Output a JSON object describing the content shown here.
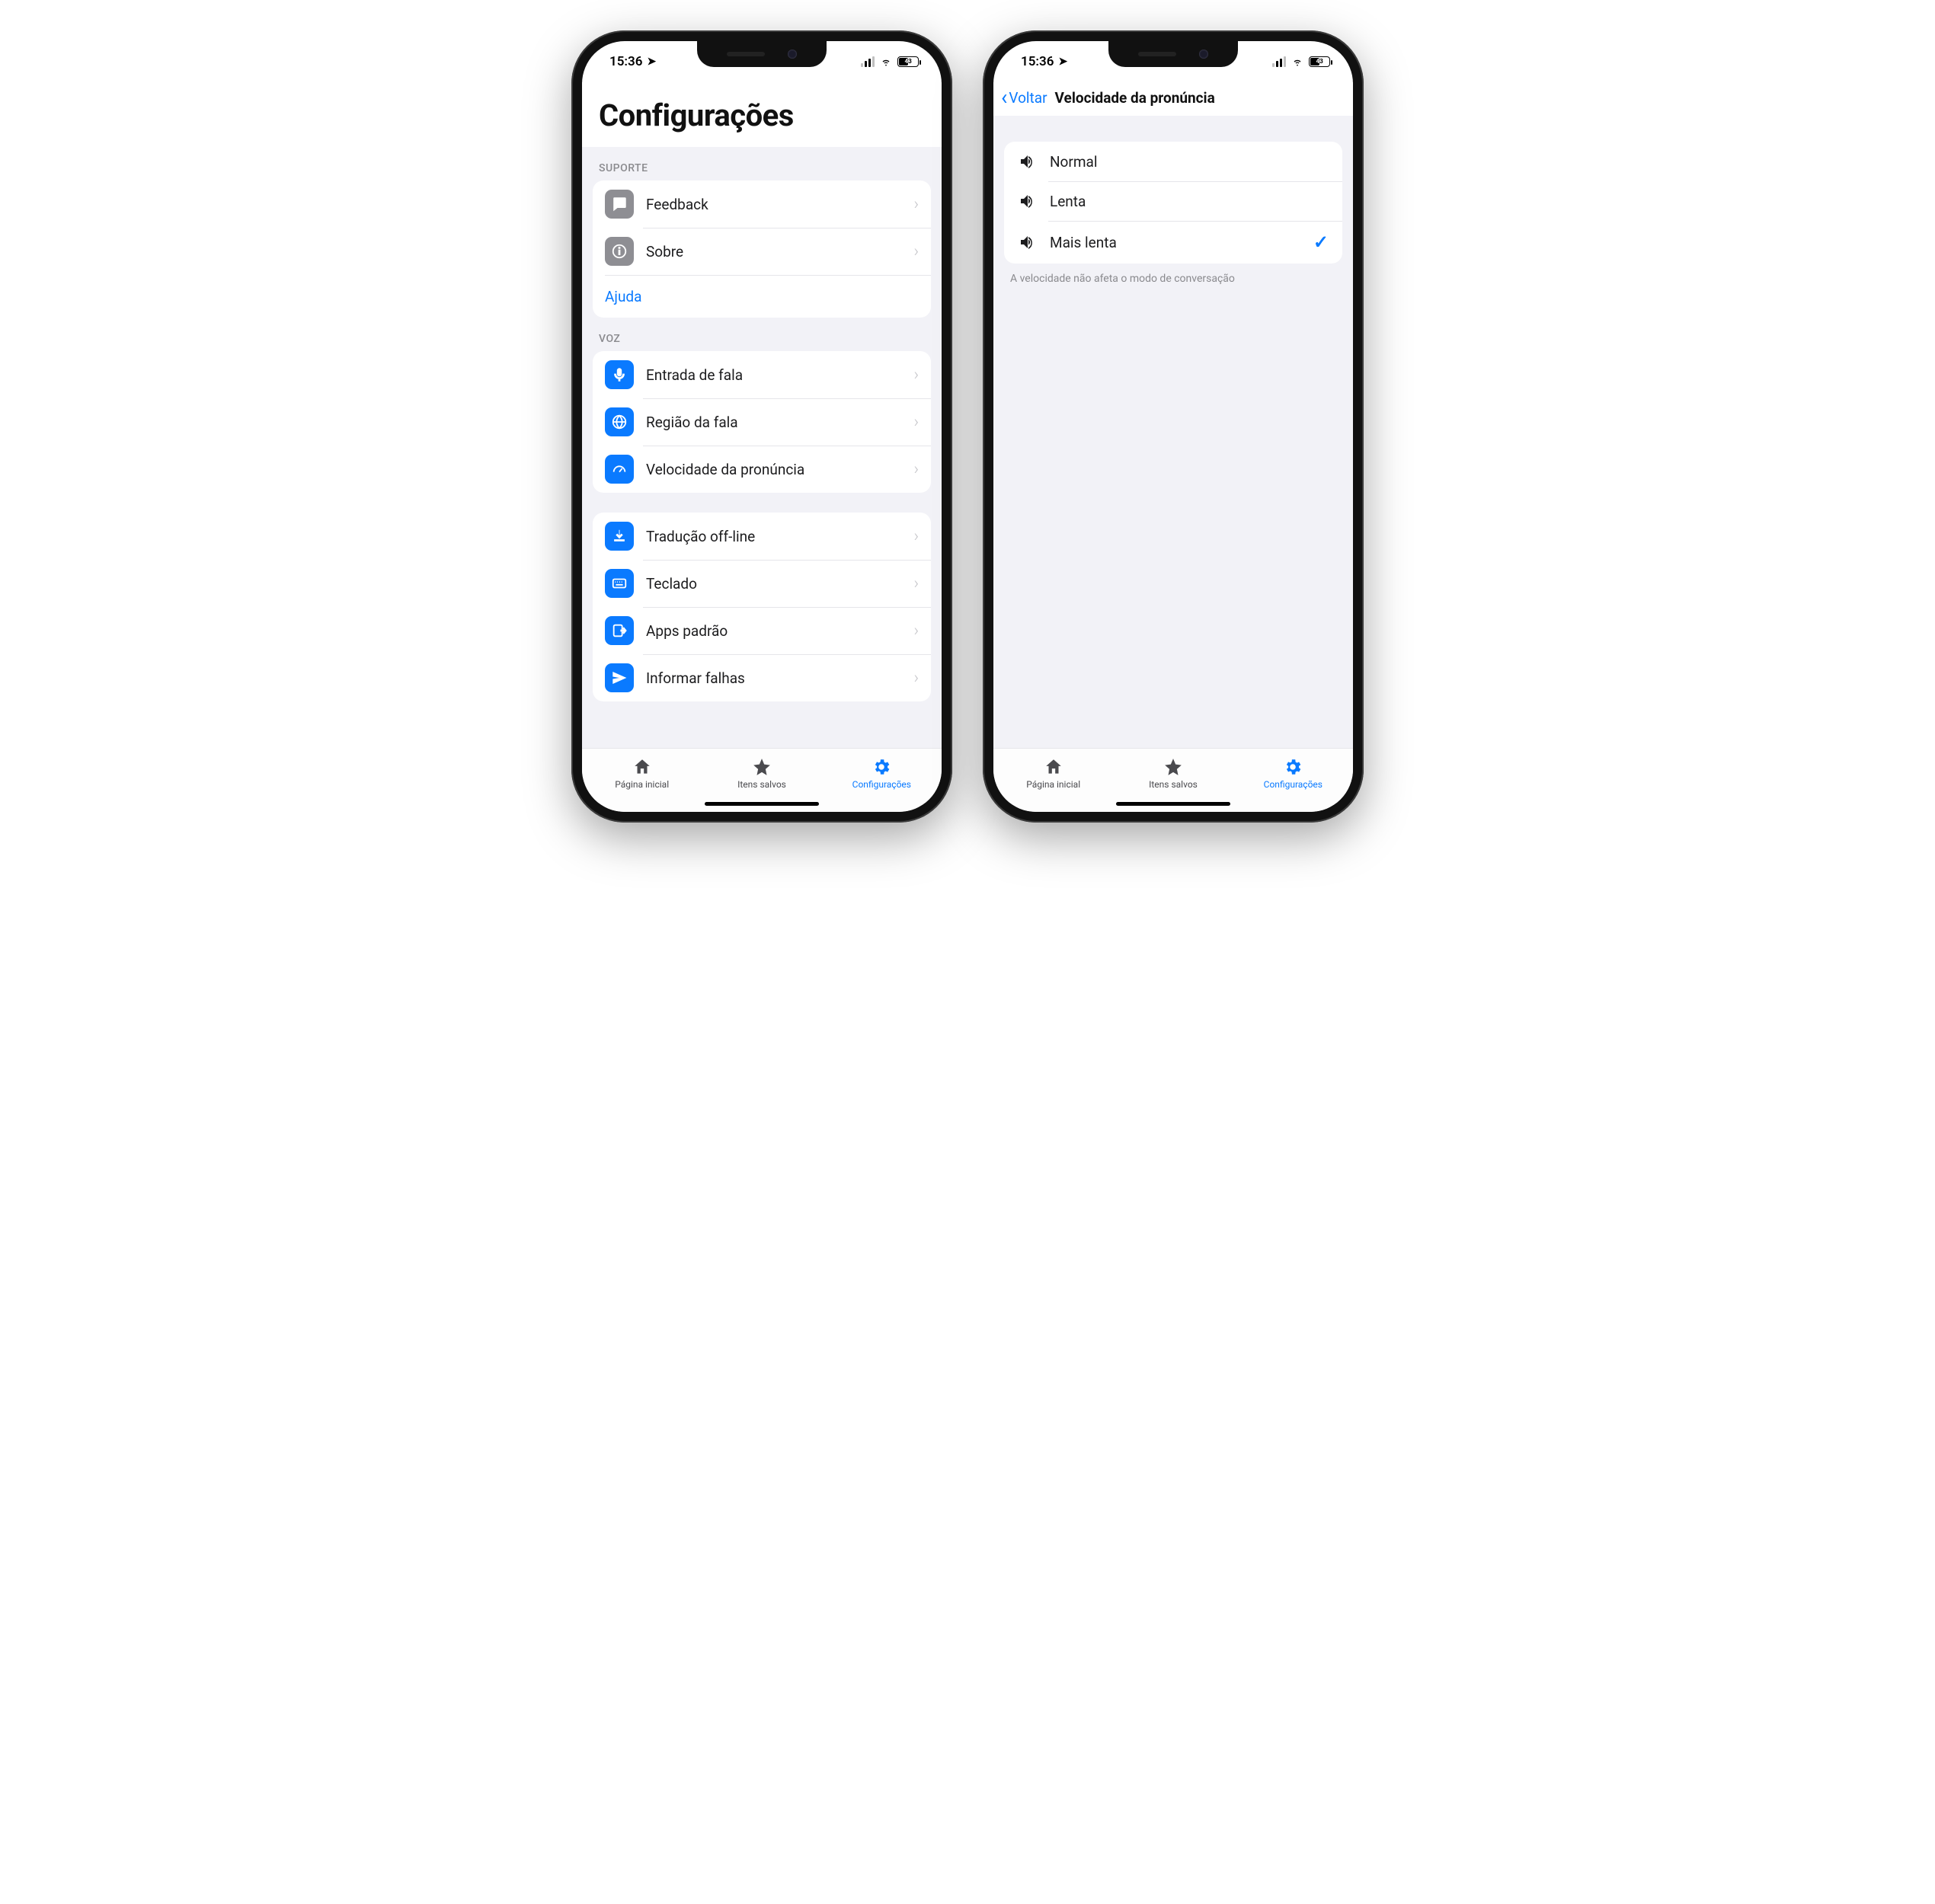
{
  "status": {
    "time": "15:36",
    "battery": "43"
  },
  "settings": {
    "title": "Configurações",
    "support_header": "SUPORTE",
    "support": {
      "feedback": "Feedback",
      "about": "Sobre",
      "help": "Ajuda"
    },
    "voice_header": "VOZ",
    "voice": {
      "speech_input": "Entrada de fala",
      "speech_region": "Região da fala",
      "speed": "Velocidade da pronúncia"
    },
    "general": {
      "offline": "Tradução off-line",
      "keyboard": "Teclado",
      "default_apps": "Apps padrão",
      "report_crashes": "Informar falhas"
    }
  },
  "speed_screen": {
    "back": "Voltar",
    "title": "Velocidade da pronúncia",
    "options": {
      "normal": "Normal",
      "slow": "Lenta",
      "slower": "Mais lenta"
    },
    "footer": "A velocidade não afeta o modo de conversação"
  },
  "tabs": {
    "home": "Página inicial",
    "saved": "Itens salvos",
    "settings": "Configurações"
  }
}
